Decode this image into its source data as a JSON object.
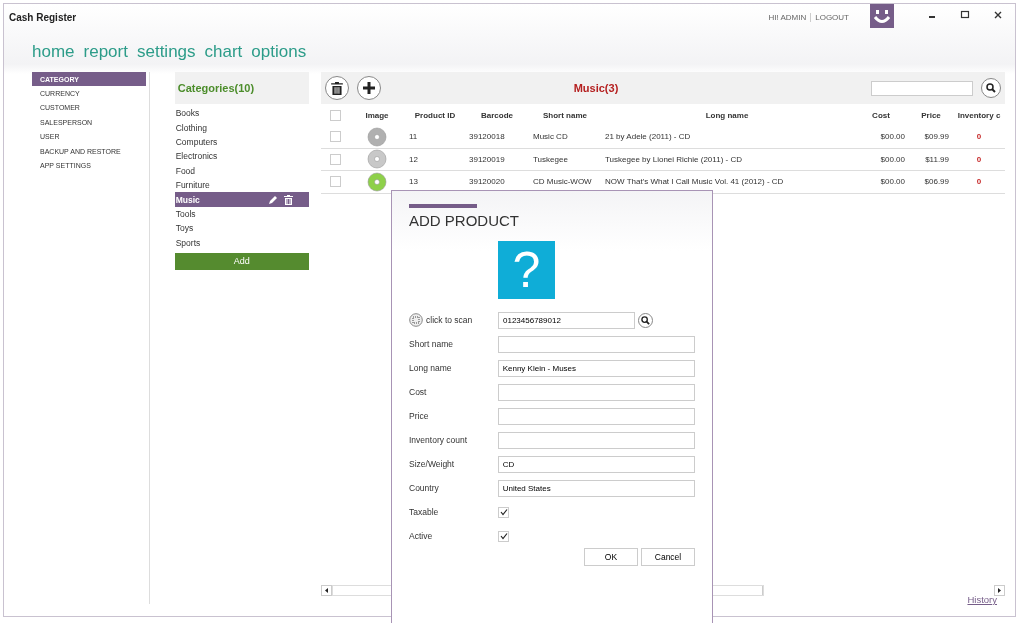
{
  "window": {
    "title": "Cash Register",
    "greeting": "HI! ADMIN",
    "logout": "LOGOUT"
  },
  "nav": [
    {
      "label": "home"
    },
    {
      "label": "report"
    },
    {
      "label": "settings"
    },
    {
      "label": "chart"
    },
    {
      "label": "options"
    }
  ],
  "sidebar": {
    "items": [
      {
        "label": "CATEGORY",
        "selected": true
      },
      {
        "label": "CURRENCY",
        "selected": false
      },
      {
        "label": "CUSTOMER",
        "selected": false
      },
      {
        "label": "SALESPERSON",
        "selected": false
      },
      {
        "label": "USER",
        "selected": false
      },
      {
        "label": "BACKUP AND RESTORE",
        "selected": false
      },
      {
        "label": "APP SETTINGS",
        "selected": false
      }
    ]
  },
  "categories": {
    "title": "Categories(10)",
    "add_button": "Add",
    "items": [
      {
        "label": "Books",
        "selected": false
      },
      {
        "label": "Clothing",
        "selected": false
      },
      {
        "label": "Computers",
        "selected": false
      },
      {
        "label": "Electronics",
        "selected": false
      },
      {
        "label": "Food",
        "selected": false
      },
      {
        "label": "Furniture",
        "selected": false
      },
      {
        "label": "Music",
        "selected": true
      },
      {
        "label": "Tools",
        "selected": false
      },
      {
        "label": "Toys",
        "selected": false
      },
      {
        "label": "Sports",
        "selected": false
      }
    ]
  },
  "products": {
    "title": "Music(3)",
    "columns": [
      "Image",
      "Product ID",
      "Barcode",
      "Short name",
      "Long name",
      "Cost",
      "Price",
      "Inventory c"
    ],
    "select_all_checked": false,
    "rows": [
      {
        "checked": false,
        "color": "#b0b0b0",
        "cells": [
          "",
          "11",
          "39120018",
          "Music CD",
          "21 by Adele (2011) - CD",
          "$00.00",
          "$09.99",
          "0"
        ]
      },
      {
        "checked": false,
        "color": "#c8c8c8",
        "cells": [
          "",
          "12",
          "39120019",
          "Tuskegee",
          "Tuskegee by Lionei Richie (2011) - CD",
          "$00.00",
          "$11.99",
          "0"
        ]
      },
      {
        "checked": false,
        "color": "#8ed04a",
        "cells": [
          "",
          "13",
          "39120020",
          "CD Music-WOW",
          "NOW That's What I Call Music Vol. 41 (2012) - CD",
          "$00.00",
          "$06.99",
          "0"
        ]
      }
    ]
  },
  "dialog": {
    "title": "ADD PRODUCT",
    "image": "?",
    "scan_label": "click to scan",
    "barcode": "0123456789012",
    "fields": [
      {
        "kind": "text",
        "label": "Short name"
      },
      {
        "kind": "text",
        "label": "Long name",
        "value": "Kenny Klein - Muses"
      },
      {
        "kind": "text",
        "label": "Cost"
      },
      {
        "kind": "text",
        "label": "Price"
      },
      {
        "kind": "text",
        "label": "Inventory count"
      },
      {
        "kind": "text",
        "label": "Size/Weight",
        "value": "CD"
      },
      {
        "kind": "text",
        "label": "Country",
        "value": "United States"
      },
      {
        "kind": "checkbox",
        "label": "Taxable",
        "checked": true
      },
      {
        "kind": "checkbox",
        "label": "Active",
        "checked": true
      }
    ],
    "buttons": [
      "OK",
      "Cancel"
    ]
  },
  "footer_link": "History"
}
